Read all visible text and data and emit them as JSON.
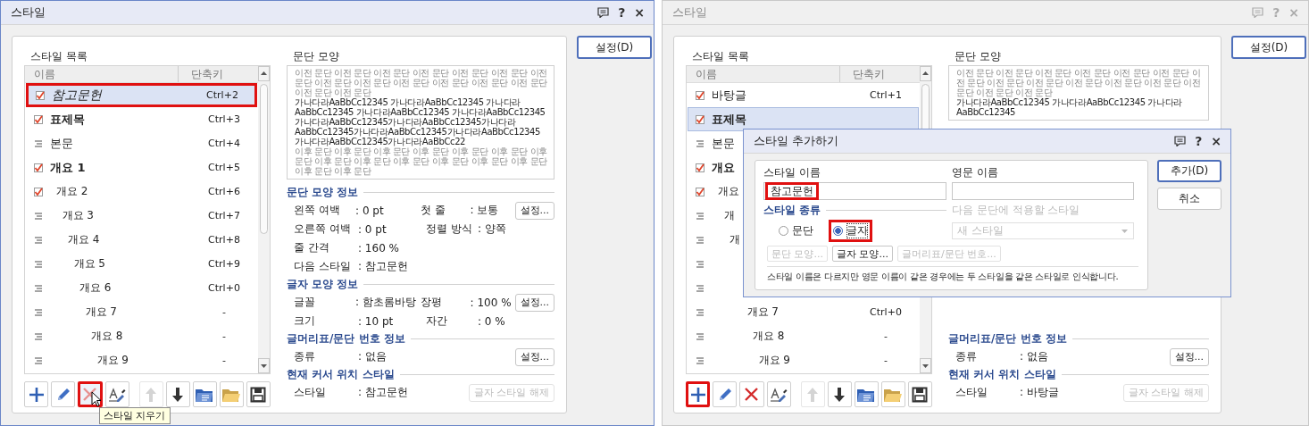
{
  "dialogs": [
    {
      "title": "스타일",
      "active": true,
      "title_buttons": [
        "?",
        "×"
      ],
      "settings_button": "설정(D)",
      "list_title": "스타일 목록",
      "columns": [
        "이름",
        "단축키"
      ],
      "rows": [
        {
          "name": "참고문헌",
          "shortcut": "Ctrl+2",
          "checked": true,
          "kind": "italic",
          "selected": true,
          "highlighted": true
        },
        {
          "name": "표제목",
          "shortcut": "Ctrl+3",
          "checked": true,
          "kind": "bold",
          "selected": false,
          "highlighted": false
        },
        {
          "name": "본문",
          "shortcut": "Ctrl+4",
          "checked": false,
          "kind": "plain",
          "selected": false,
          "highlighted": false
        },
        {
          "name": "개요 1",
          "shortcut": "Ctrl+5",
          "checked": true,
          "kind": "bold",
          "selected": false,
          "highlighted": false
        },
        {
          "name": "개요 2",
          "shortcut": "Ctrl+6",
          "checked": true,
          "kind": "outline",
          "selected": false,
          "highlighted": false
        },
        {
          "name": "개요 3",
          "shortcut": "Ctrl+7",
          "checked": false,
          "kind": "outline",
          "selected": false,
          "highlighted": false
        },
        {
          "name": "개요 4",
          "shortcut": "Ctrl+8",
          "checked": false,
          "kind": "outline",
          "selected": false,
          "highlighted": false
        },
        {
          "name": "개요 5",
          "shortcut": "Ctrl+9",
          "checked": false,
          "kind": "outline",
          "selected": false,
          "highlighted": false
        },
        {
          "name": "개요 6",
          "shortcut": "Ctrl+0",
          "checked": false,
          "kind": "outline",
          "selected": false,
          "highlighted": false
        },
        {
          "name": "개요 7",
          "shortcut": "-",
          "checked": false,
          "kind": "outline",
          "selected": false,
          "highlighted": false
        },
        {
          "name": "개요 8",
          "shortcut": "-",
          "checked": false,
          "kind": "outline",
          "selected": false,
          "highlighted": false
        },
        {
          "name": "개요 9",
          "shortcut": "-",
          "checked": false,
          "kind": "outline",
          "selected": false,
          "highlighted": false
        }
      ],
      "preview_title": "문단 모양",
      "preview": [
        {
          "kind": "prev",
          "text": "이전 문단 이전 문단 이전 문단 이전 문단 이전 문단 이전 문단 이전 문단 이전 문단 이전 문단 이전 문단 이전 문단 이전 문단 이전 문단 이전 문단 이전 문단"
        },
        {
          "kind": "cur",
          "text": "가나다라AaBbCc12345 가나다라AaBbCc12345 가나다라AaBbCc12345 가나다라AaBbCc12345 가나다라AaBbCc12345 가나다라AaBbCc12345가나다라AaBbCc12345가나다라AaBbCc12345가나다라AaBbCc12345가나다라AaBbCc12345가나다라AaBbCc12345가나다라AaBbCc22"
        },
        {
          "kind": "next",
          "text": "이후 문단 이후 문단 이후 문단 이후 문단 이후 문단 이후 문단 이후 문단 이후 문단 이후 문단 이후 문단 이후 문단 이후 문단 이후 문단 이후 문단 이후 문단"
        }
      ],
      "sections": [
        {
          "title": "문단 모양 정보",
          "rows": [
            {
              "cells": [
                {
                  "label": "왼쪽 여백",
                  "value": ": 0 pt"
                },
                {
                  "label": "첫 줄",
                  "value": ": 보통"
                }
              ],
              "button": {
                "label": "설정...",
                "disabled": false
              }
            },
            {
              "cells": [
                {
                  "label": "오른쪽 여백",
                  "value": ": 0 pt"
                },
                {
                  "label": "정렬 방식",
                  "value": ": 양쪽"
                }
              ]
            },
            {
              "cells": [
                {
                  "label": "줄 간격",
                  "value": ": 160 %"
                }
              ]
            },
            {
              "cells": [
                {
                  "label": "다음 스타일",
                  "value": ": 참고문헌"
                }
              ]
            }
          ]
        },
        {
          "title": "글자 모양 정보",
          "rows": [
            {
              "cells": [
                {
                  "label": "글꼴",
                  "value": ": 함초롬바탕"
                },
                {
                  "label": "장평",
                  "value": ": 100 %"
                }
              ],
              "button": {
                "label": "설정...",
                "disabled": false
              }
            },
            {
              "cells": [
                {
                  "label": "크기",
                  "value": ": 10 pt"
                },
                {
                  "label": "자간",
                  "value": ": 0 %"
                }
              ]
            }
          ]
        },
        {
          "title": "글머리표/문단 번호 정보",
          "rows": [
            {
              "cells": [
                {
                  "label": "종류",
                  "value": ": 없음"
                }
              ],
              "button": {
                "label": "설정...",
                "disabled": false
              }
            }
          ]
        },
        {
          "title": "현재 커서 위치 스타일",
          "rows": [
            {
              "cells": [
                {
                  "label": "스타일",
                  "value": ": 참고문헌"
                }
              ],
              "button": {
                "label": "글자 스타일 해제",
                "disabled": true
              }
            }
          ]
        }
      ],
      "toolbar": [
        {
          "kind": "add",
          "disabled": false,
          "highlighted": false,
          "hovered": false
        },
        {
          "kind": "edit",
          "disabled": false,
          "highlighted": false,
          "hovered": false
        },
        {
          "kind": "delete",
          "disabled": false,
          "highlighted": true,
          "hovered": true
        },
        {
          "kind": "pick",
          "disabled": false,
          "highlighted": false,
          "hovered": false
        },
        {
          "kind": "up",
          "disabled": true,
          "highlighted": false,
          "hovered": false
        },
        {
          "kind": "down",
          "disabled": false,
          "highlighted": false,
          "hovered": false
        },
        {
          "kind": "import",
          "disabled": false,
          "highlighted": false,
          "hovered": false
        },
        {
          "kind": "open",
          "disabled": false,
          "highlighted": false,
          "hovered": false
        },
        {
          "kind": "save",
          "disabled": false,
          "highlighted": false,
          "hovered": false
        }
      ],
      "tooltip": "스타일 지우기"
    },
    {
      "title": "스타일",
      "active": false,
      "title_buttons": [
        "?",
        "×"
      ],
      "settings_button": "설정(D)",
      "list_title": "스타일 목록",
      "columns": [
        "이름",
        "단축키"
      ],
      "rows": [
        {
          "name": "바탕글",
          "shortcut": "Ctrl+1",
          "checked": true,
          "kind": "plain",
          "selected": false,
          "highlighted": false
        },
        {
          "name": "표제목",
          "checked": true,
          "kind": "bold",
          "selected": true,
          "highlighted": false
        },
        {
          "name": "본문",
          "checked": false,
          "kind": "plain",
          "selected": false,
          "highlighted": false
        },
        {
          "name": "개요",
          "checked": true,
          "kind": "bold",
          "selected": false,
          "highlighted": false
        },
        {
          "name": "개요",
          "checked": true,
          "kind": "outline",
          "selected": false,
          "highlighted": false
        },
        {
          "name": "개",
          "checked": false,
          "kind": "outline",
          "selected": false,
          "highlighted": false
        },
        {
          "name": "개",
          "checked": false,
          "kind": "outline",
          "selected": false,
          "highlighted": false
        },
        {
          "checked": false,
          "kind": "outline",
          "selected": false,
          "highlighted": false
        },
        {
          "checked": false,
          "kind": "outline",
          "selected": false,
          "highlighted": false
        },
        {
          "name": "개요 7",
          "shortcut": "Ctrl+0",
          "checked": false,
          "kind": "outline",
          "selected": false,
          "highlighted": false
        },
        {
          "name": "개요 8",
          "shortcut": "-",
          "checked": false,
          "kind": "outline",
          "selected": false,
          "highlighted": false
        },
        {
          "name": "개요 9",
          "shortcut": "-",
          "checked": false,
          "kind": "outline",
          "selected": false,
          "highlighted": false
        }
      ],
      "preview_title": "문단 모양",
      "preview": [
        {
          "kind": "prev",
          "text": "이전 문단 이전 문단 이전 문단 이전 문단 이전 문단 이전 문단 이전 문단 이전 문단 이전 문단 이전 문단 이전 문단 이전 문단 이전 문단 이전 문단 이전 문단"
        },
        {
          "kind": "cur",
          "text": "가나다라AaBbCc12345 가나다라AaBbCc12345 가나다라AaBbCc12345"
        }
      ],
      "sections": [
        {
          "title": "글머리표/문단 번호 정보",
          "rows": [
            {
              "cells": [
                {
                  "label": "종류",
                  "value": ": 없음"
                }
              ],
              "button": {
                "label": "설정...",
                "disabled": false
              }
            }
          ]
        },
        {
          "title": "현재 커서 위치 스타일",
          "rows": [
            {
              "cells": [
                {
                  "label": "스타일",
                  "value": ": 바탕글"
                }
              ],
              "button": {
                "label": "글자 스타일 해제",
                "disabled": true
              }
            }
          ]
        }
      ],
      "toolbar": [
        {
          "kind": "add",
          "disabled": false,
          "highlighted": true,
          "hovered": false
        },
        {
          "kind": "edit",
          "disabled": false,
          "highlighted": false,
          "hovered": false
        },
        {
          "kind": "delete",
          "disabled": false,
          "highlighted": false,
          "hovered": false
        },
        {
          "kind": "pick",
          "disabled": false,
          "highlighted": false,
          "hovered": false
        },
        {
          "kind": "up",
          "disabled": true,
          "highlighted": false,
          "hovered": false
        },
        {
          "kind": "down",
          "disabled": false,
          "highlighted": false,
          "hovered": false
        },
        {
          "kind": "import",
          "disabled": false,
          "highlighted": false,
          "hovered": false
        },
        {
          "kind": "open",
          "disabled": false,
          "highlighted": false,
          "hovered": false
        },
        {
          "kind": "save",
          "disabled": false,
          "highlighted": false,
          "hovered": false
        }
      ]
    }
  ],
  "add_dialog": {
    "title": "스타일 추가하기",
    "title_buttons": [
      "?",
      "×"
    ],
    "name_label": "스타일 이름",
    "name_value": "참고문헌",
    "name_highlighted": true,
    "english_label": "영문 이름",
    "kind_heading": "스타일 종류",
    "kinds": [
      {
        "label": "문단",
        "selected": false,
        "highlighted": false
      },
      {
        "label": "글자",
        "selected": true,
        "highlighted": true
      }
    ],
    "next_label": "다음 문단에 적용할 스타일",
    "next_value": "새 스타일",
    "next_disabled": true,
    "buttons": [
      {
        "label": "문단 모양...",
        "disabled": true
      },
      {
        "label": "글자 모양...",
        "disabled": false
      },
      {
        "label": "글머리표/문단 번호...",
        "disabled": true
      }
    ],
    "note": "스타일 이름은 다르지만 영문 이름이 같은 경우에는 두 스타일을 같은 스타일로 인식합니다.",
    "actions": [
      {
        "label": "추가(D)",
        "default": true
      },
      {
        "label": "취소",
        "default": false
      }
    ]
  }
}
